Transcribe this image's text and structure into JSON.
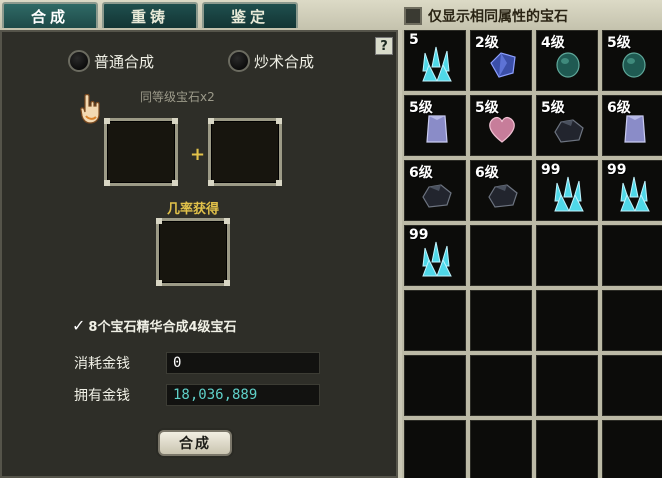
{
  "tabs": [
    {
      "label": "合成",
      "active": true
    },
    {
      "label": "重铸",
      "active": false
    },
    {
      "label": "鉴定",
      "active": false
    }
  ],
  "filter": {
    "label": "仅显示相同属性的宝石",
    "checked": false
  },
  "panel": {
    "help": "?",
    "mode_normal": "普通合成",
    "mode_special": "炒术合成",
    "input_hint": "同等级宝石x2",
    "plus": "+",
    "chance_label": "几率获得",
    "essence_check": "✓",
    "essence_label": "8个宝石精华合成4级宝石",
    "cost_label": "消耗金钱",
    "cost_value": "0",
    "own_label": "拥有金钱",
    "own_value": "18,036,889",
    "own_color": "#5fd0c8",
    "cost_color": "#ffffff",
    "combine_button": "合成"
  },
  "inventory": [
    {
      "label": "5",
      "icon": "cyan-crystal-icon"
    },
    {
      "label": "2级",
      "icon": "blue-gem-icon"
    },
    {
      "label": "4级",
      "icon": "teal-gem-icon"
    },
    {
      "label": "5级",
      "icon": "teal-gem-icon"
    },
    {
      "label": "5级",
      "icon": "violet-crystal-icon"
    },
    {
      "label": "5级",
      "icon": "pink-heart-gem-icon"
    },
    {
      "label": "5级",
      "icon": "dark-ore-icon"
    },
    {
      "label": "6级",
      "icon": "violet-crystal-icon"
    },
    {
      "label": "6级",
      "icon": "dark-ore-icon"
    },
    {
      "label": "6级",
      "icon": "dark-ore-icon"
    },
    {
      "label": "99",
      "icon": "cyan-crystal-icon"
    },
    {
      "label": "99",
      "icon": "cyan-crystal-icon"
    },
    {
      "label": "99",
      "icon": "cyan-crystal-icon"
    },
    {
      "label": "",
      "icon": ""
    },
    {
      "label": "",
      "icon": ""
    },
    {
      "label": "",
      "icon": ""
    },
    {
      "label": "",
      "icon": ""
    },
    {
      "label": "",
      "icon": ""
    },
    {
      "label": "",
      "icon": ""
    },
    {
      "label": "",
      "icon": ""
    },
    {
      "label": "",
      "icon": ""
    },
    {
      "label": "",
      "icon": ""
    },
    {
      "label": "",
      "icon": ""
    },
    {
      "label": "",
      "icon": ""
    },
    {
      "label": "",
      "icon": ""
    },
    {
      "label": "",
      "icon": ""
    },
    {
      "label": "",
      "icon": ""
    },
    {
      "label": "",
      "icon": ""
    }
  ]
}
